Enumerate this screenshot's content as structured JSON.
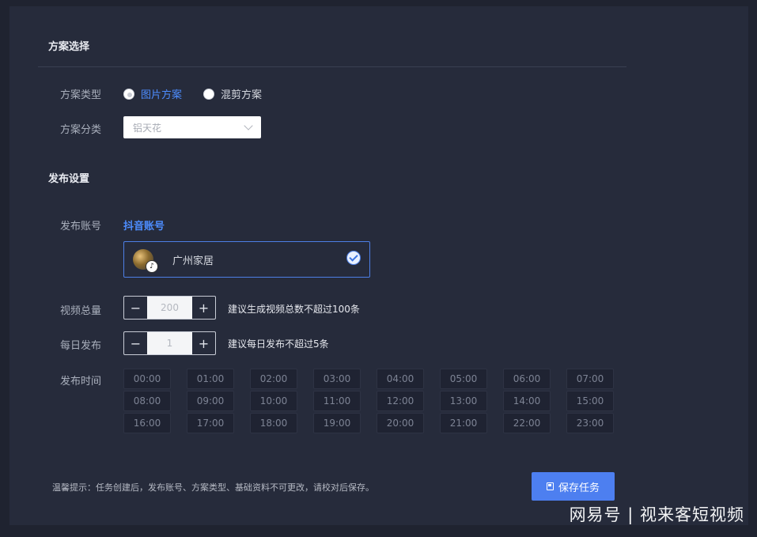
{
  "plan_section": {
    "title": "方案选择",
    "type_label": "方案类型",
    "type_options": [
      "图片方案",
      "混剪方案"
    ],
    "category_label": "方案分类",
    "category_value": "铝天花"
  },
  "publish_section": {
    "title": "发布设置",
    "account_label": "发布账号",
    "platform_link": "抖音账号",
    "account_name": "广州家居",
    "total_label": "视频总量",
    "total_value": "200",
    "total_hint": "建议生成视频总数不超过100条",
    "daily_label": "每日发布",
    "daily_value": "1",
    "daily_hint": "建议每日发布不超过5条",
    "time_label": "发布时间",
    "times": [
      "00:00",
      "01:00",
      "02:00",
      "03:00",
      "04:00",
      "05:00",
      "06:00",
      "07:00",
      "08:00",
      "09:00",
      "10:00",
      "11:00",
      "12:00",
      "13:00",
      "14:00",
      "15:00",
      "16:00",
      "17:00",
      "18:00",
      "19:00",
      "20:00",
      "21:00",
      "22:00",
      "23:00"
    ]
  },
  "footer": {
    "tip": "温馨提示：任务创建后，发布账号、方案类型、基础资料不可更改，请校对后保存。",
    "save_label": "保存任务"
  },
  "watermark": "网易号 | 视来客短视频",
  "colors": {
    "accent": "#4d7ff0",
    "link": "#4d8dff",
    "panel": "#262b3b",
    "background": "#1f2330"
  }
}
